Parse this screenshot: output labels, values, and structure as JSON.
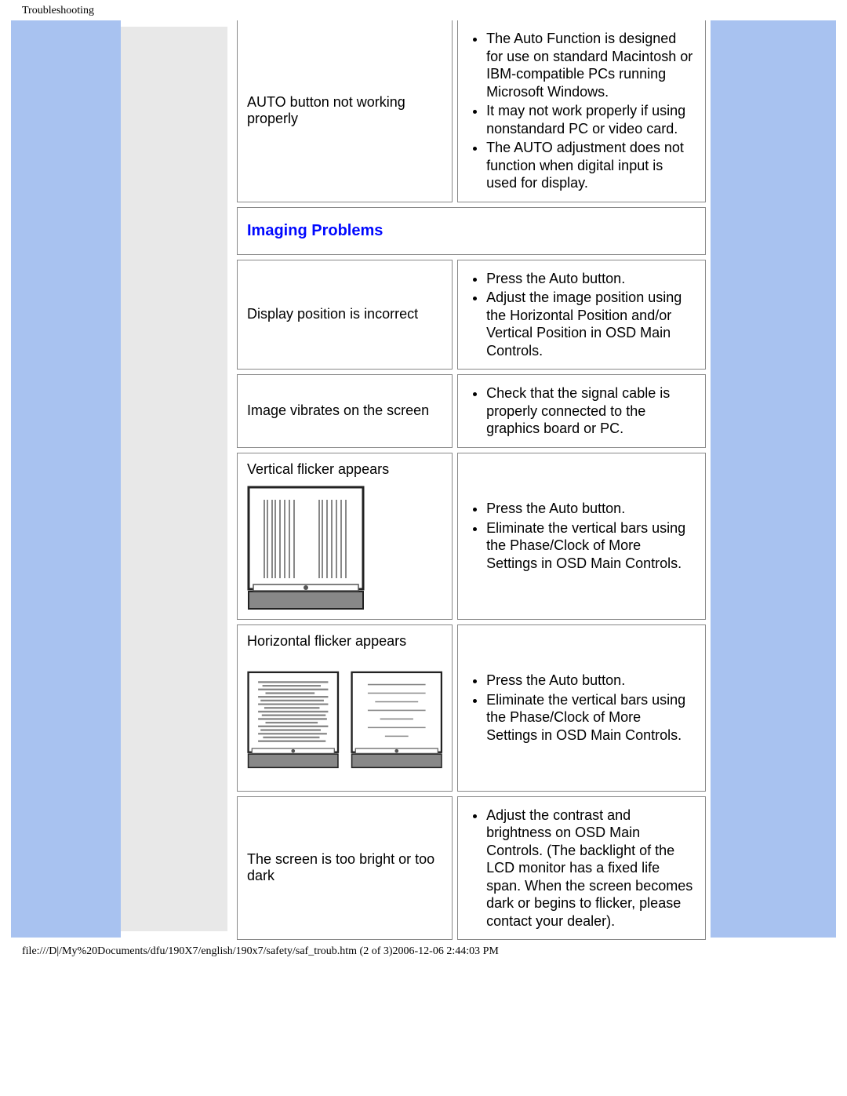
{
  "header": {
    "title": "Troubleshooting"
  },
  "rows": {
    "auto_button": {
      "label": "AUTO button not working properly",
      "items": [
        "The Auto Function is designed for use on standard Macintosh or IBM-compatible PCs running Microsoft Windows.",
        "It may not work properly if using nonstandard PC or video card.",
        "The AUTO adjustment does not function when digital input is used for display."
      ]
    },
    "section_imaging": "Imaging Problems",
    "display_position": {
      "label": "Display position is incorrect",
      "items": [
        "Press the Auto button.",
        "Adjust the image position using the Horizontal Position and/or Vertical Position in OSD Main Controls."
      ]
    },
    "image_vibrates": {
      "label": "Image vibrates on the screen",
      "items": [
        "Check that the signal cable is properly connected to the graphics board or PC."
      ]
    },
    "vertical_flicker": {
      "label": "Vertical flicker appears",
      "items": [
        "Press the Auto button.",
        "Eliminate the vertical bars using the Phase/Clock of More Settings in OSD Main Controls."
      ]
    },
    "horizontal_flicker": {
      "label": "Horizontal flicker appears",
      "items": [
        "Press the Auto button.",
        "Eliminate the vertical bars using the Phase/Clock of More Settings in OSD Main Controls."
      ]
    },
    "brightness": {
      "label": "The screen is too bright or too dark",
      "items": [
        "Adjust the contrast and brightness on OSD Main Controls. (The backlight of the LCD monitor has a fixed life span. When the screen becomes dark or begins to flicker, please contact your dealer)."
      ]
    }
  },
  "footer": {
    "path": "file:///D|/My%20Documents/dfu/190X7/english/190x7/safety/saf_troub.htm (2 of 3)2006-12-06 2:44:03 PM"
  }
}
